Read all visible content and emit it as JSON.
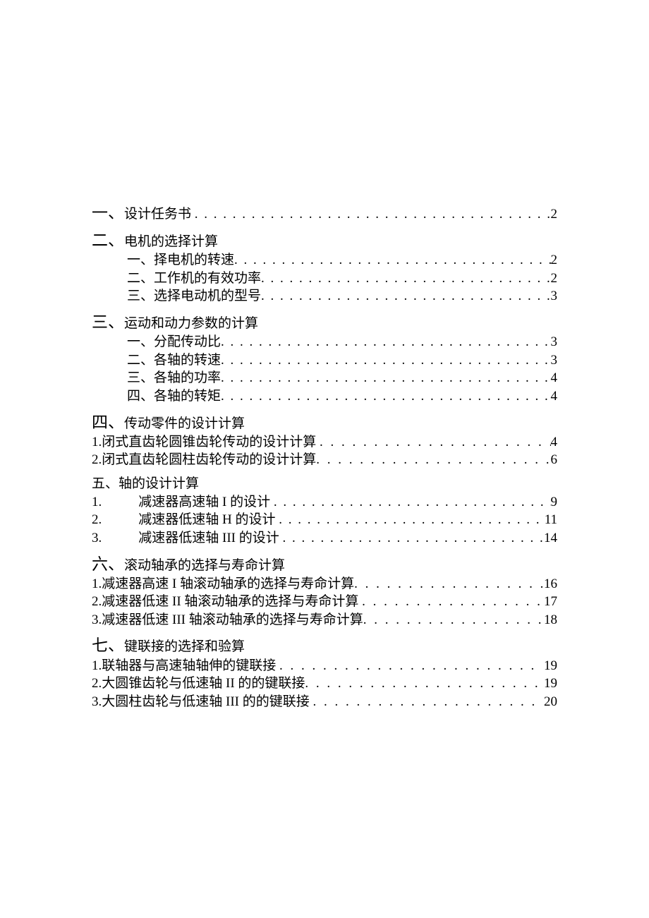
{
  "s1": {
    "num": "一、",
    "title": "设计任务书",
    "page": "2"
  },
  "s2": {
    "num": "二、",
    "title": "电机的选择计算",
    "subs": [
      {
        "num": "一、",
        "title": "择电机的转速",
        "page": "2"
      },
      {
        "num": "二、",
        "title": "工作机的有效功率",
        "page": "2"
      },
      {
        "num": "三、",
        "title": "选择电动机的型号",
        "page": "3"
      }
    ]
  },
  "s3": {
    "num": "三、",
    "title": "运动和动力参数的计算",
    "subs": [
      {
        "num": "一、",
        "title": "分配传动比",
        "page": "3"
      },
      {
        "num": "二、",
        "title": "各轴的转速",
        "page": "3"
      },
      {
        "num": "三、",
        "title": "各轴的功率",
        "page": "4"
      },
      {
        "num": "四、",
        "title": "各轴的转矩",
        "page": "4"
      }
    ]
  },
  "s4": {
    "num": "四、",
    "title": "传动零件的设计计算",
    "subs": [
      {
        "num": "1",
        "sep": " .",
        "title": "闭式直齿轮圆锥齿轮传动的设计计算",
        "page": "4"
      },
      {
        "num": "2",
        "sep": "  .",
        "title": "闭式直齿轮圆柱齿轮传动的设计计算",
        "page": "6"
      }
    ]
  },
  "s5": {
    "num": "五、",
    "title": "轴的设计计算",
    "subs": [
      {
        "num": "1.",
        "title": "减速器高速轴 I 的设计",
        "page": "9"
      },
      {
        "num": "2.",
        "title": "减速器低速轴 H 的设计",
        "page": "11"
      },
      {
        "num": "3.",
        "title": "减速器低速轴 III 的设计",
        "page": "14"
      }
    ]
  },
  "s6": {
    "num": "六、",
    "title": "滚动轴承的选择与寿命计算",
    "subs": [
      {
        "num": "1",
        "sep": " . ",
        "title": "减速器高速 I 轴滚动轴承的选择与寿命计算",
        "page": "16"
      },
      {
        "num": "2",
        "sep": "   . ",
        "title": "减速器低速 II 轴滚动轴承的选择与寿命计算",
        "page": "17"
      },
      {
        "num": "3",
        "sep": "  .",
        "title": "减速器低速 III 轴滚动轴承的选择与寿命计算",
        "page": "18"
      }
    ]
  },
  "s7": {
    "num": "七、",
    "title": "键联接的选择和验算",
    "subs": [
      {
        "num": "1",
        "sep": " .",
        "title": "联轴器与高速轴轴伸的键联接",
        "page": "19"
      },
      {
        "num": "2",
        "sep": "  .",
        "title": "大圆锥齿轮与低速轴 II 的的键联接",
        "page": "19"
      },
      {
        "num": "3",
        "sep": "  .    ",
        "title": "大圆柱齿轮与低速轴 III 的的键联接",
        "page": "20"
      }
    ]
  }
}
